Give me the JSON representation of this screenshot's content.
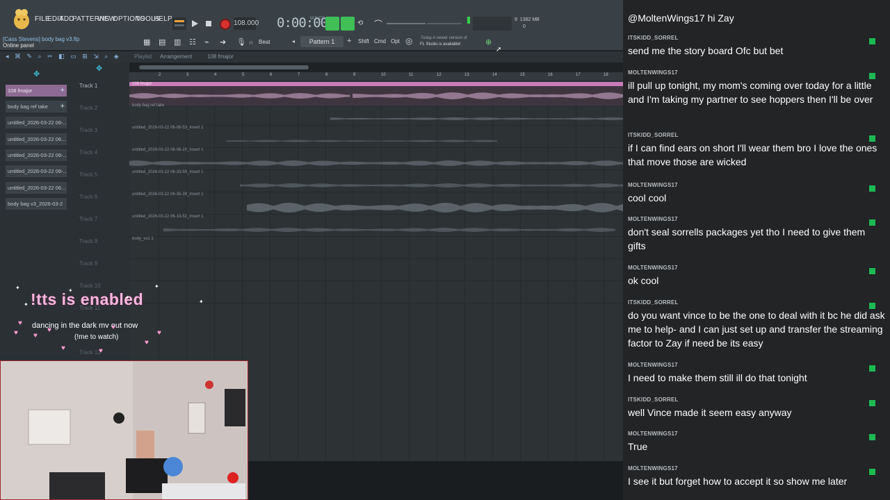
{
  "fl": {
    "menus": [
      "FILE",
      "EDIT",
      "ADD",
      "PATTERNS",
      "VIEW",
      "OPTIONS",
      "TOOLS",
      "HELP"
    ],
    "project_line": "[Cass Stevens] body bag v3.flp",
    "online_panel": "Online panel",
    "tempo": "108.000",
    "time": "0:00:00",
    "time_unit": "M:S:CS",
    "cpu": "9",
    "ram": "1382 MB",
    "ram2": "0",
    "snap": "Beat",
    "pattern": "Pattern 1",
    "buttons": {
      "shift": "Shift",
      "cmd": "Cmd",
      "opt": "Opt"
    },
    "news": {
      "line1": "Today  A newer version of",
      "line2": "FL Studio is available!"
    },
    "playlist": {
      "crumb1": "Playlist",
      "crumb2": "Arrangement",
      "crumb3": "108 fmajor"
    },
    "clips": [
      "108 fmajor",
      "body bag ref take",
      "untitled_2026-03-22 06-...",
      "untitled_2026-03-22 06...",
      "untitled_2026-03-22 06-...",
      "untitled_2026-03-22 06-...",
      "untitled_2026-03-22 06...",
      "body bag v3_2026-03-2"
    ],
    "tracks": [
      "Track 1",
      "Track 2",
      "Track 3",
      "Track 4",
      "Track 5",
      "Track 6",
      "Track 7",
      "Track 8",
      "Track 9",
      "Track 10",
      "Track 11",
      "Track 12"
    ],
    "track_clip_names": [
      "108 fmajor",
      "body bag ref take",
      "untitled_2026-03-22 06-06-53_Insert 1",
      "untitled_2026-03-22 06-08-20_Insert 1",
      "untitled_2026-03-22 06-33-59_Insert 1",
      "untitled_2026-03-22 06-35-39_Insert 1",
      "untitled_2026-03-22 06-19-52_Insert 1",
      "body_vs1 1"
    ],
    "bars": [
      "2",
      "3",
      "4",
      "5",
      "6",
      "7",
      "8",
      "9",
      "10",
      "11",
      "12",
      "13",
      "14",
      "15",
      "16",
      "17",
      "18"
    ]
  },
  "overlay": {
    "tts": "!tts is enabled",
    "mv": "dancing in the dark mv out now",
    "mv_sub": "(!me to watch)"
  },
  "chat": [
    {
      "user": "",
      "text": "@MoltenWings17 hi Zay"
    },
    {
      "user": "ITSKIDD_SORREL",
      "text": "send me the story board Ofc but bet"
    },
    {
      "user": "MOLTENWINGS17",
      "text": "ill pull up tonight, my mom's coming over today for a little and I'm taking my partner to see hoppers then I'll be over"
    },
    {
      "user": "ITSKIDD_SORREL",
      "text": "if I can find ears on short I'll wear them bro I love the ones that move those are wicked"
    },
    {
      "user": "MOLTENWINGS17",
      "text": "cool cool"
    },
    {
      "user": "MOLTENWINGS17",
      "text": "don't seal sorrells packages yet tho I need to give them gifts"
    },
    {
      "user": "MOLTENWINGS17",
      "text": "ok cool"
    },
    {
      "user": "ITSKIDD_SORREL",
      "text": "do you want vince to be the one to deal with it bc he did ask me to help- and I can just set up and transfer the streaming factor to Zay if need be its easy"
    },
    {
      "user": "MOLTENWINGS17",
      "text": "I need to make them still ill do that tonight"
    },
    {
      "user": "ITSKIDD_SORREL",
      "text": "well Vince made it seem easy anyway"
    },
    {
      "user": "MOLTENWINGS17",
      "text": "True"
    },
    {
      "user": "MOLTENWINGS17",
      "text": "I see it but forget how to accept it so show me later"
    }
  ],
  "colors": {
    "accent": "#3fbf56",
    "clip_pink": "#c97ab8",
    "record": "#d8322f",
    "tts_pink": "#f8b7df",
    "badge": "#1db954"
  }
}
